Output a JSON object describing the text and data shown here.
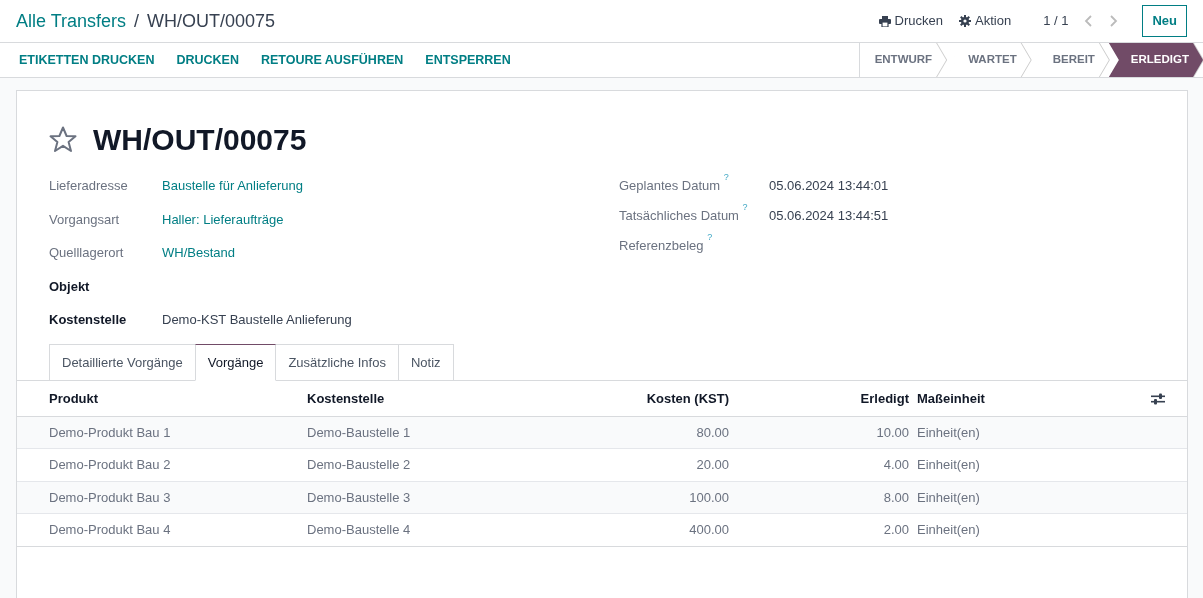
{
  "breadcrumb": {
    "parent": "Alle Transfers",
    "separator": "/",
    "current": "WH/OUT/00075"
  },
  "top_actions": [
    {
      "label": "Drucken",
      "kind": "print"
    },
    {
      "label": "Aktion",
      "kind": "action"
    }
  ],
  "pager": "1 / 1",
  "new_button": "Neu",
  "action_buttons": [
    "ETIKETTEN DRUCKEN",
    "DRUCKEN",
    "RETOURE AUSFÜHREN",
    "ENTSPERREN"
  ],
  "stages": [
    {
      "label": "ENTWURF",
      "selected": false
    },
    {
      "label": "WARTET",
      "selected": false
    },
    {
      "label": "BEREIT",
      "selected": false
    },
    {
      "label": "ERLEDIGT",
      "selected": true
    }
  ],
  "record": {
    "title": "WH/OUT/00075",
    "starred": false
  },
  "left_fields": [
    {
      "label": "Lieferadresse",
      "bold": false,
      "kind": "link",
      "value": "Baustelle für Anlieferung"
    },
    {
      "label": "Vorgangsart",
      "bold": false,
      "kind": "link",
      "value": "Haller: Lieferaufträge"
    },
    {
      "label": "Quelllagerort",
      "bold": false,
      "kind": "link",
      "value": "WH/Bestand"
    },
    {
      "label": "Objekt",
      "bold": true,
      "kind": "text"
    },
    {
      "label": "Kostenstelle",
      "bold": true,
      "kind": "text",
      "value": "Demo-KST Baustelle Anlieferung"
    }
  ],
  "right_fields": [
    {
      "label": "Geplantes Datum",
      "help": "?",
      "value": "05.06.2024 13:44:01"
    },
    {
      "label": "Tatsächliches Datum",
      "help": "?",
      "value": "05.06.2024 13:44:51"
    },
    {
      "label": "Referenzbeleg",
      "help": "?"
    }
  ],
  "tabs": [
    {
      "label": "Detaillierte Vorgänge",
      "selected": false
    },
    {
      "label": "Vorgänge",
      "selected": true
    },
    {
      "label": "Zusätzliche Infos",
      "selected": false
    },
    {
      "label": "Notiz",
      "selected": false
    }
  ],
  "table": {
    "columns": [
      "Produkt",
      "Kostenstelle",
      "Kosten (KST)",
      "Erledigt",
      "Maßeinheit"
    ],
    "rows": [
      [
        "Demo-Produkt Bau 1",
        "Demo-Baustelle 1",
        "80.00",
        "10.00",
        "Einheit(en)"
      ],
      [
        "Demo-Produkt Bau 2",
        "Demo-Baustelle 2",
        "20.00",
        "4.00",
        "Einheit(en)"
      ],
      [
        "Demo-Produkt Bau 3",
        "Demo-Baustelle 3",
        "100.00",
        "8.00",
        "Einheit(en)"
      ],
      [
        "Demo-Produkt Bau 4",
        "Demo-Baustelle 4",
        "400.00",
        "2.00",
        "Einheit(en)"
      ]
    ]
  }
}
